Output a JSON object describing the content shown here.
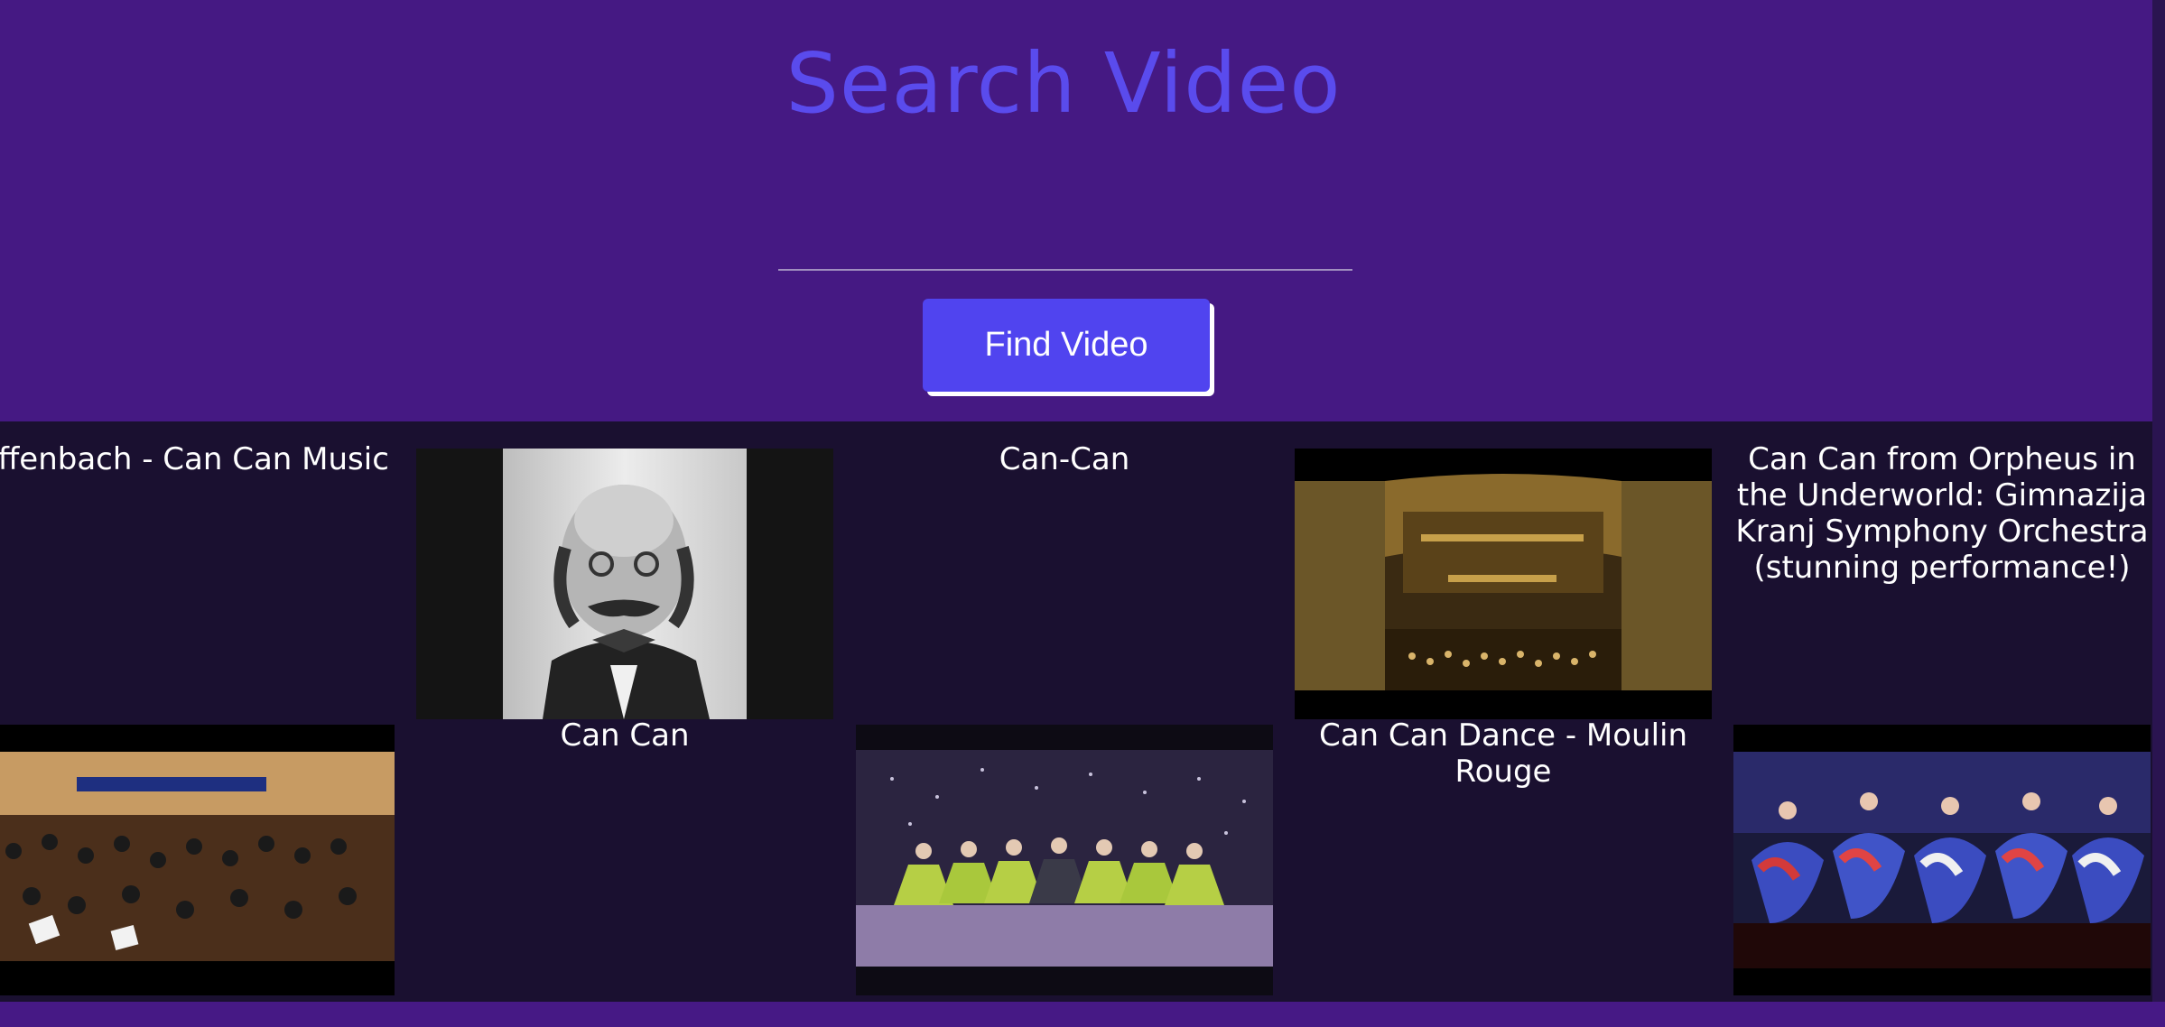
{
  "header": {
    "title": "Search Video",
    "search": {
      "value": "",
      "placeholder": ""
    },
    "button_label": "Find Video"
  },
  "results": [
    {
      "type": "caption",
      "text": "Offenbach - Can Can Music"
    },
    {
      "type": "thumbnail",
      "icon": "portrait-thumbnail"
    },
    {
      "type": "caption",
      "text": "Can-Can"
    },
    {
      "type": "thumbnail",
      "icon": "concert-hall-thumbnail"
    },
    {
      "type": "caption",
      "text": "Can Can from Orpheus in the Underworld: Gimnazija Kranj Symphony Orchestra (stunning performance!)"
    },
    {
      "type": "thumbnail",
      "icon": "orchestra-thumbnail"
    },
    {
      "type": "caption",
      "text": "Can Can"
    },
    {
      "type": "thumbnail",
      "icon": "dancers-thumbnail"
    },
    {
      "type": "caption",
      "text": "Can Can Dance - Moulin Rouge"
    },
    {
      "type": "thumbnail",
      "icon": "stage-dancers-thumbnail"
    }
  ],
  "colors": {
    "background": "#461985",
    "results_background": "#1a1030",
    "title": "#5a4bed",
    "button": "#5044ef"
  }
}
